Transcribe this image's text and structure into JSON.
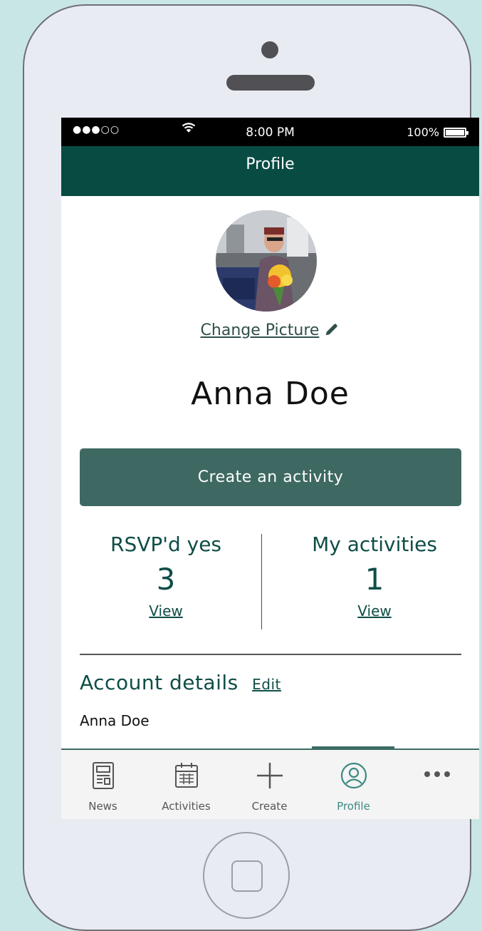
{
  "status_bar": {
    "signal": "●●●○○",
    "time": "8:00 PM",
    "battery": "100%",
    "battery_level": 1.0
  },
  "header": {
    "title": "Profile"
  },
  "profile": {
    "change_picture": "Change Picture",
    "name": "Anna Doe"
  },
  "create_button": {
    "label": "Create an activity"
  },
  "stats": {
    "rsvp": {
      "label": "RSVP'd yes",
      "count": "3",
      "link": "View"
    },
    "my_activities": {
      "label": "My activities",
      "count": "1",
      "link": "View"
    }
  },
  "account": {
    "title": "Account details",
    "edit": "Edit",
    "name": "Anna Doe"
  },
  "tabs": [
    {
      "label": "News",
      "icon": "newspaper-icon"
    },
    {
      "label": "Activities",
      "icon": "calendar-icon"
    },
    {
      "label": "Create",
      "icon": "plus-icon"
    },
    {
      "label": "Profile",
      "icon": "profile-icon",
      "active": true
    },
    {
      "label": "",
      "icon": "more-icon"
    }
  ],
  "colors": {
    "brand": "#084b43",
    "button": "#3e6962",
    "accent": "#3b8a81",
    "background": "#c9e6e6"
  }
}
